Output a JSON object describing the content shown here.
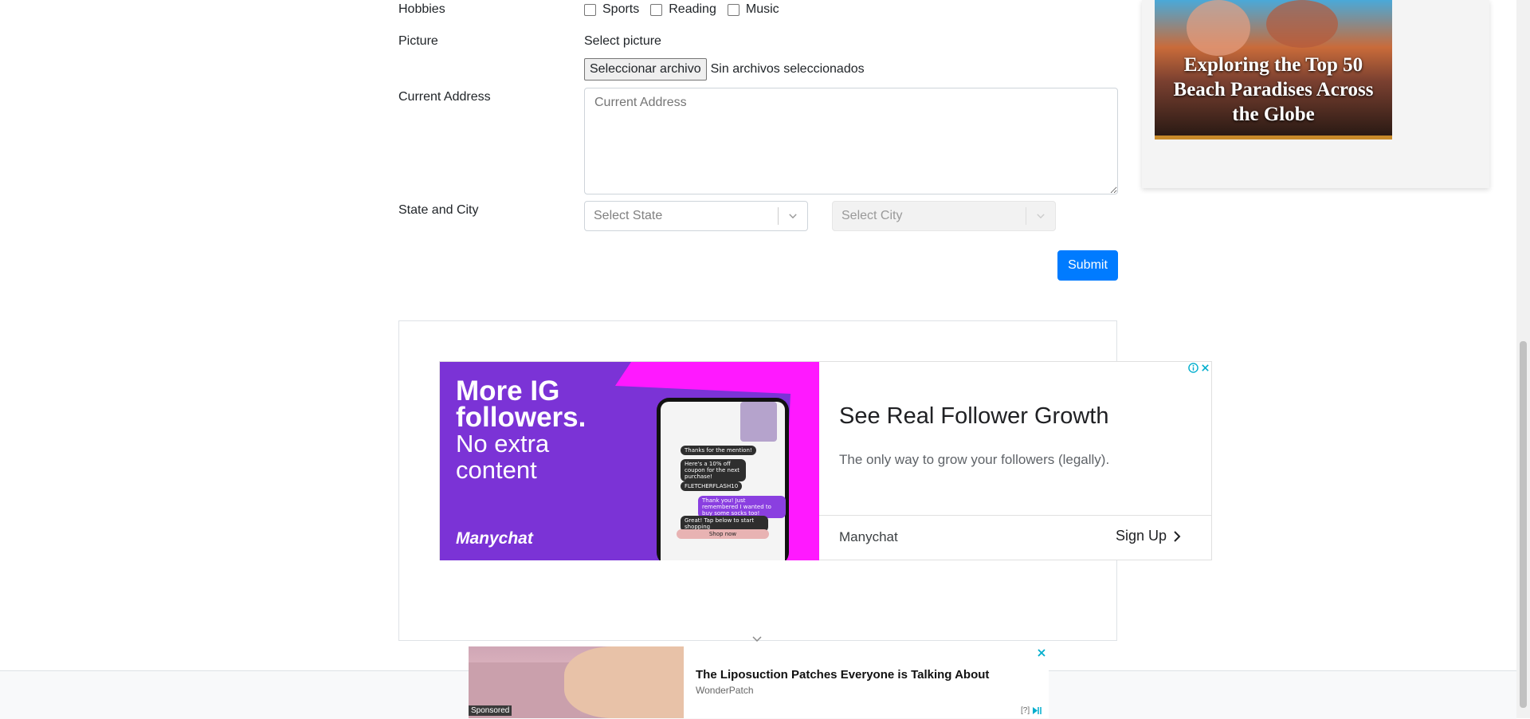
{
  "form": {
    "hobbies_label": "Hobbies",
    "hobbies": [
      "Sports",
      "Reading",
      "Music"
    ],
    "picture_label": "Picture",
    "picture_hint": "Select picture",
    "file_button": "Seleccionar archivo",
    "file_status": "Sin archivos seleccionados",
    "address_label": "Current Address",
    "address_placeholder": "Current Address",
    "state_city_label": "State and City",
    "state_placeholder": "Select State",
    "city_placeholder": "Select City",
    "submit": "Submit"
  },
  "side_ad": {
    "headline": "Exploring the Top 50 Beach Paradises Across the Globe"
  },
  "banner_ad": {
    "left_line1": "More IG",
    "left_line2": "followers.",
    "left_line3": "No extra",
    "left_line4": "content",
    "brand_logo": "Manychat",
    "phone_msgs": [
      "Thanks for the mention!",
      "Here's a 10% off coupon for the next purchase!",
      "FLETCHERFLASH10",
      "Thank you! Just remembered I wanted to buy some socks too!",
      "Great! Tap below to start shopping",
      "Shop now"
    ],
    "title": "See Real Follower Growth",
    "desc": "The only way to grow your followers (legally).",
    "advertiser": "Manychat",
    "cta": "Sign Up",
    "info_icon": "info-icon",
    "close_icon": "close-icon"
  },
  "sticky_ad": {
    "title": "The Liposuction Patches Everyone is Talking About",
    "advertiser": "WonderPatch",
    "sponsored": "Sponsored",
    "help": "[?]"
  },
  "colors": {
    "primary": "#007bff",
    "ad_purple": "#7b33d6",
    "ad_magenta": "#ff19ff",
    "close_teal": "#00aecd"
  }
}
